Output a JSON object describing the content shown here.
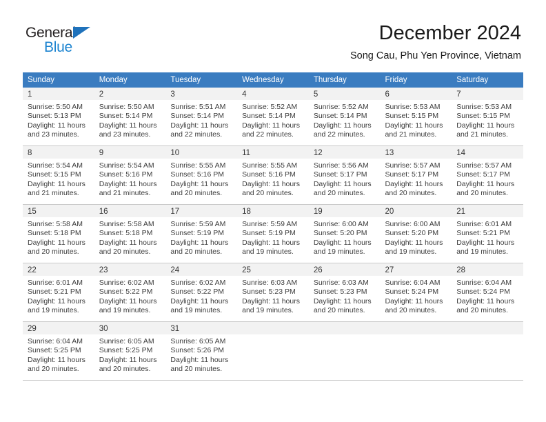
{
  "brand": {
    "name_part1": "General",
    "name_part2": "Blue",
    "colors": {
      "dark": "#231f20",
      "blue": "#1d84d0",
      "header_blue": "#3a7cc0",
      "band_gray": "#f2f2f2"
    }
  },
  "header": {
    "title": "December 2024",
    "subtitle": "Song Cau, Phu Yen Province, Vietnam"
  },
  "weekdays": [
    "Sunday",
    "Monday",
    "Tuesday",
    "Wednesday",
    "Thursday",
    "Friday",
    "Saturday"
  ],
  "weeks": [
    [
      {
        "day": "1",
        "sunrise": "Sunrise: 5:50 AM",
        "sunset": "Sunset: 5:13 PM",
        "daylight": "Daylight: 11 hours and 23 minutes."
      },
      {
        "day": "2",
        "sunrise": "Sunrise: 5:50 AM",
        "sunset": "Sunset: 5:14 PM",
        "daylight": "Daylight: 11 hours and 23 minutes."
      },
      {
        "day": "3",
        "sunrise": "Sunrise: 5:51 AM",
        "sunset": "Sunset: 5:14 PM",
        "daylight": "Daylight: 11 hours and 22 minutes."
      },
      {
        "day": "4",
        "sunrise": "Sunrise: 5:52 AM",
        "sunset": "Sunset: 5:14 PM",
        "daylight": "Daylight: 11 hours and 22 minutes."
      },
      {
        "day": "5",
        "sunrise": "Sunrise: 5:52 AM",
        "sunset": "Sunset: 5:14 PM",
        "daylight": "Daylight: 11 hours and 22 minutes."
      },
      {
        "day": "6",
        "sunrise": "Sunrise: 5:53 AM",
        "sunset": "Sunset: 5:15 PM",
        "daylight": "Daylight: 11 hours and 21 minutes."
      },
      {
        "day": "7",
        "sunrise": "Sunrise: 5:53 AM",
        "sunset": "Sunset: 5:15 PM",
        "daylight": "Daylight: 11 hours and 21 minutes."
      }
    ],
    [
      {
        "day": "8",
        "sunrise": "Sunrise: 5:54 AM",
        "sunset": "Sunset: 5:15 PM",
        "daylight": "Daylight: 11 hours and 21 minutes."
      },
      {
        "day": "9",
        "sunrise": "Sunrise: 5:54 AM",
        "sunset": "Sunset: 5:16 PM",
        "daylight": "Daylight: 11 hours and 21 minutes."
      },
      {
        "day": "10",
        "sunrise": "Sunrise: 5:55 AM",
        "sunset": "Sunset: 5:16 PM",
        "daylight": "Daylight: 11 hours and 20 minutes."
      },
      {
        "day": "11",
        "sunrise": "Sunrise: 5:55 AM",
        "sunset": "Sunset: 5:16 PM",
        "daylight": "Daylight: 11 hours and 20 minutes."
      },
      {
        "day": "12",
        "sunrise": "Sunrise: 5:56 AM",
        "sunset": "Sunset: 5:17 PM",
        "daylight": "Daylight: 11 hours and 20 minutes."
      },
      {
        "day": "13",
        "sunrise": "Sunrise: 5:57 AM",
        "sunset": "Sunset: 5:17 PM",
        "daylight": "Daylight: 11 hours and 20 minutes."
      },
      {
        "day": "14",
        "sunrise": "Sunrise: 5:57 AM",
        "sunset": "Sunset: 5:17 PM",
        "daylight": "Daylight: 11 hours and 20 minutes."
      }
    ],
    [
      {
        "day": "15",
        "sunrise": "Sunrise: 5:58 AM",
        "sunset": "Sunset: 5:18 PM",
        "daylight": "Daylight: 11 hours and 20 minutes."
      },
      {
        "day": "16",
        "sunrise": "Sunrise: 5:58 AM",
        "sunset": "Sunset: 5:18 PM",
        "daylight": "Daylight: 11 hours and 20 minutes."
      },
      {
        "day": "17",
        "sunrise": "Sunrise: 5:59 AM",
        "sunset": "Sunset: 5:19 PM",
        "daylight": "Daylight: 11 hours and 20 minutes."
      },
      {
        "day": "18",
        "sunrise": "Sunrise: 5:59 AM",
        "sunset": "Sunset: 5:19 PM",
        "daylight": "Daylight: 11 hours and 19 minutes."
      },
      {
        "day": "19",
        "sunrise": "Sunrise: 6:00 AM",
        "sunset": "Sunset: 5:20 PM",
        "daylight": "Daylight: 11 hours and 19 minutes."
      },
      {
        "day": "20",
        "sunrise": "Sunrise: 6:00 AM",
        "sunset": "Sunset: 5:20 PM",
        "daylight": "Daylight: 11 hours and 19 minutes."
      },
      {
        "day": "21",
        "sunrise": "Sunrise: 6:01 AM",
        "sunset": "Sunset: 5:21 PM",
        "daylight": "Daylight: 11 hours and 19 minutes."
      }
    ],
    [
      {
        "day": "22",
        "sunrise": "Sunrise: 6:01 AM",
        "sunset": "Sunset: 5:21 PM",
        "daylight": "Daylight: 11 hours and 19 minutes."
      },
      {
        "day": "23",
        "sunrise": "Sunrise: 6:02 AM",
        "sunset": "Sunset: 5:22 PM",
        "daylight": "Daylight: 11 hours and 19 minutes."
      },
      {
        "day": "24",
        "sunrise": "Sunrise: 6:02 AM",
        "sunset": "Sunset: 5:22 PM",
        "daylight": "Daylight: 11 hours and 19 minutes."
      },
      {
        "day": "25",
        "sunrise": "Sunrise: 6:03 AM",
        "sunset": "Sunset: 5:23 PM",
        "daylight": "Daylight: 11 hours and 19 minutes."
      },
      {
        "day": "26",
        "sunrise": "Sunrise: 6:03 AM",
        "sunset": "Sunset: 5:23 PM",
        "daylight": "Daylight: 11 hours and 20 minutes."
      },
      {
        "day": "27",
        "sunrise": "Sunrise: 6:04 AM",
        "sunset": "Sunset: 5:24 PM",
        "daylight": "Daylight: 11 hours and 20 minutes."
      },
      {
        "day": "28",
        "sunrise": "Sunrise: 6:04 AM",
        "sunset": "Sunset: 5:24 PM",
        "daylight": "Daylight: 11 hours and 20 minutes."
      }
    ],
    [
      {
        "day": "29",
        "sunrise": "Sunrise: 6:04 AM",
        "sunset": "Sunset: 5:25 PM",
        "daylight": "Daylight: 11 hours and 20 minutes."
      },
      {
        "day": "30",
        "sunrise": "Sunrise: 6:05 AM",
        "sunset": "Sunset: 5:25 PM",
        "daylight": "Daylight: 11 hours and 20 minutes."
      },
      {
        "day": "31",
        "sunrise": "Sunrise: 6:05 AM",
        "sunset": "Sunset: 5:26 PM",
        "daylight": "Daylight: 11 hours and 20 minutes."
      },
      {
        "day": "",
        "sunrise": "",
        "sunset": "",
        "daylight": ""
      },
      {
        "day": "",
        "sunrise": "",
        "sunset": "",
        "daylight": ""
      },
      {
        "day": "",
        "sunrise": "",
        "sunset": "",
        "daylight": ""
      },
      {
        "day": "",
        "sunrise": "",
        "sunset": "",
        "daylight": ""
      }
    ]
  ]
}
